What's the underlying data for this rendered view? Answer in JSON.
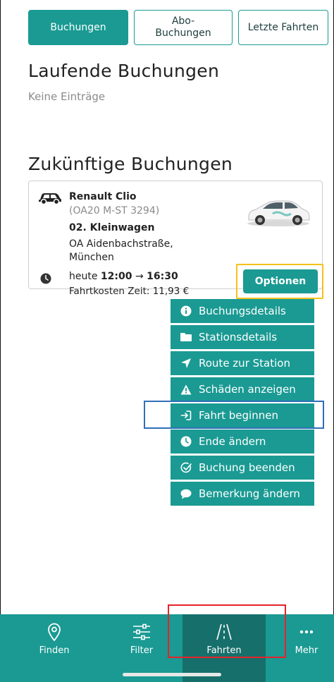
{
  "tabs": [
    {
      "label": "Buchungen",
      "active": true
    },
    {
      "label": "Abo-\nBuchungen",
      "active": false
    },
    {
      "label": "Letzte Fahrten",
      "active": false
    }
  ],
  "running": {
    "title": "Laufende Buchungen",
    "empty": "Keine Einträge"
  },
  "future": {
    "title": "Zukünftige Buchungen"
  },
  "booking": {
    "car_name": "Renault Clio",
    "plate": "(OA20 M-ST 3294)",
    "category": "02. Kleinwagen",
    "station_line1": "OA Aidenbachstraße,",
    "station_line2": "München",
    "time_prefix": "heute ",
    "time_start": "12:00",
    "time_arrow": " → ",
    "time_end": "16:30",
    "cost": "Fahrtkosten Zeit: 11,93 €"
  },
  "options_label": "Optionen",
  "menu": [
    {
      "label": "Buchungsdetails",
      "icon": "info-icon"
    },
    {
      "label": "Stationsdetails",
      "icon": "folder-icon"
    },
    {
      "label": "Route zur Station",
      "icon": "navigation-arrow-icon"
    },
    {
      "label": "Schäden anzeigen",
      "icon": "warning-icon"
    },
    {
      "label": "Fahrt beginnen",
      "icon": "sign-in-icon"
    },
    {
      "label": "Ende ändern",
      "icon": "clock-icon"
    },
    {
      "label": "Buchung beenden",
      "icon": "check-circle-icon"
    },
    {
      "label": "Bemerkung ändern",
      "icon": "comment-icon"
    }
  ],
  "nav": [
    {
      "label": "Finden",
      "icon": "location-pin-icon"
    },
    {
      "label": "Filter",
      "icon": "sliders-icon"
    },
    {
      "label": "Fahrten",
      "icon": "road-icon",
      "active": true
    },
    {
      "label": "Mehr",
      "icon": "more-dots-icon"
    }
  ],
  "colors": {
    "accent": "#1a9a93",
    "accent_dark": "#166f6b",
    "highlight_yellow": "#f4c21b",
    "highlight_blue": "#2f6fb8",
    "highlight_red": "#e5232a"
  }
}
